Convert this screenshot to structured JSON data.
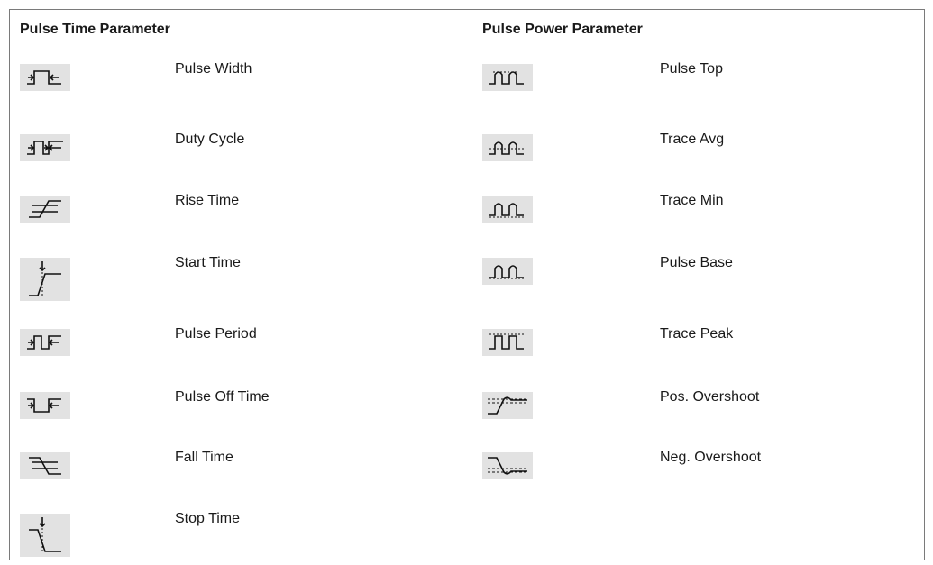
{
  "pulse_time": {
    "header": "Pulse Time Parameter",
    "items": [
      {
        "label": "Pulse Width",
        "icon": "pulse-width-icon"
      },
      {
        "label": "Duty Cycle",
        "icon": "duty-cycle-icon"
      },
      {
        "label": "Rise Time",
        "icon": "rise-time-icon"
      },
      {
        "label": "Start Time",
        "icon": "start-time-icon"
      },
      {
        "label": "Pulse Period",
        "icon": "pulse-period-icon"
      },
      {
        "label": "Pulse Off Time",
        "icon": "pulse-off-time-icon"
      },
      {
        "label": "Fall Time",
        "icon": "fall-time-icon"
      },
      {
        "label": "Stop Time",
        "icon": "stop-time-icon"
      }
    ]
  },
  "pulse_power": {
    "header": "Pulse Power Parameter",
    "items": [
      {
        "label": "Pulse Top",
        "icon": "pulse-top-icon"
      },
      {
        "label": "Trace Avg",
        "icon": "trace-avg-icon"
      },
      {
        "label": "Trace Min",
        "icon": "trace-min-icon"
      },
      {
        "label": "Pulse Base",
        "icon": "pulse-base-icon"
      },
      {
        "label": "Trace Peak",
        "icon": "trace-peak-icon"
      },
      {
        "label": "Pos. Overshoot",
        "icon": "pos-overshoot-icon"
      },
      {
        "label": "Neg. Overshoot",
        "icon": "neg-overshoot-icon"
      }
    ]
  }
}
